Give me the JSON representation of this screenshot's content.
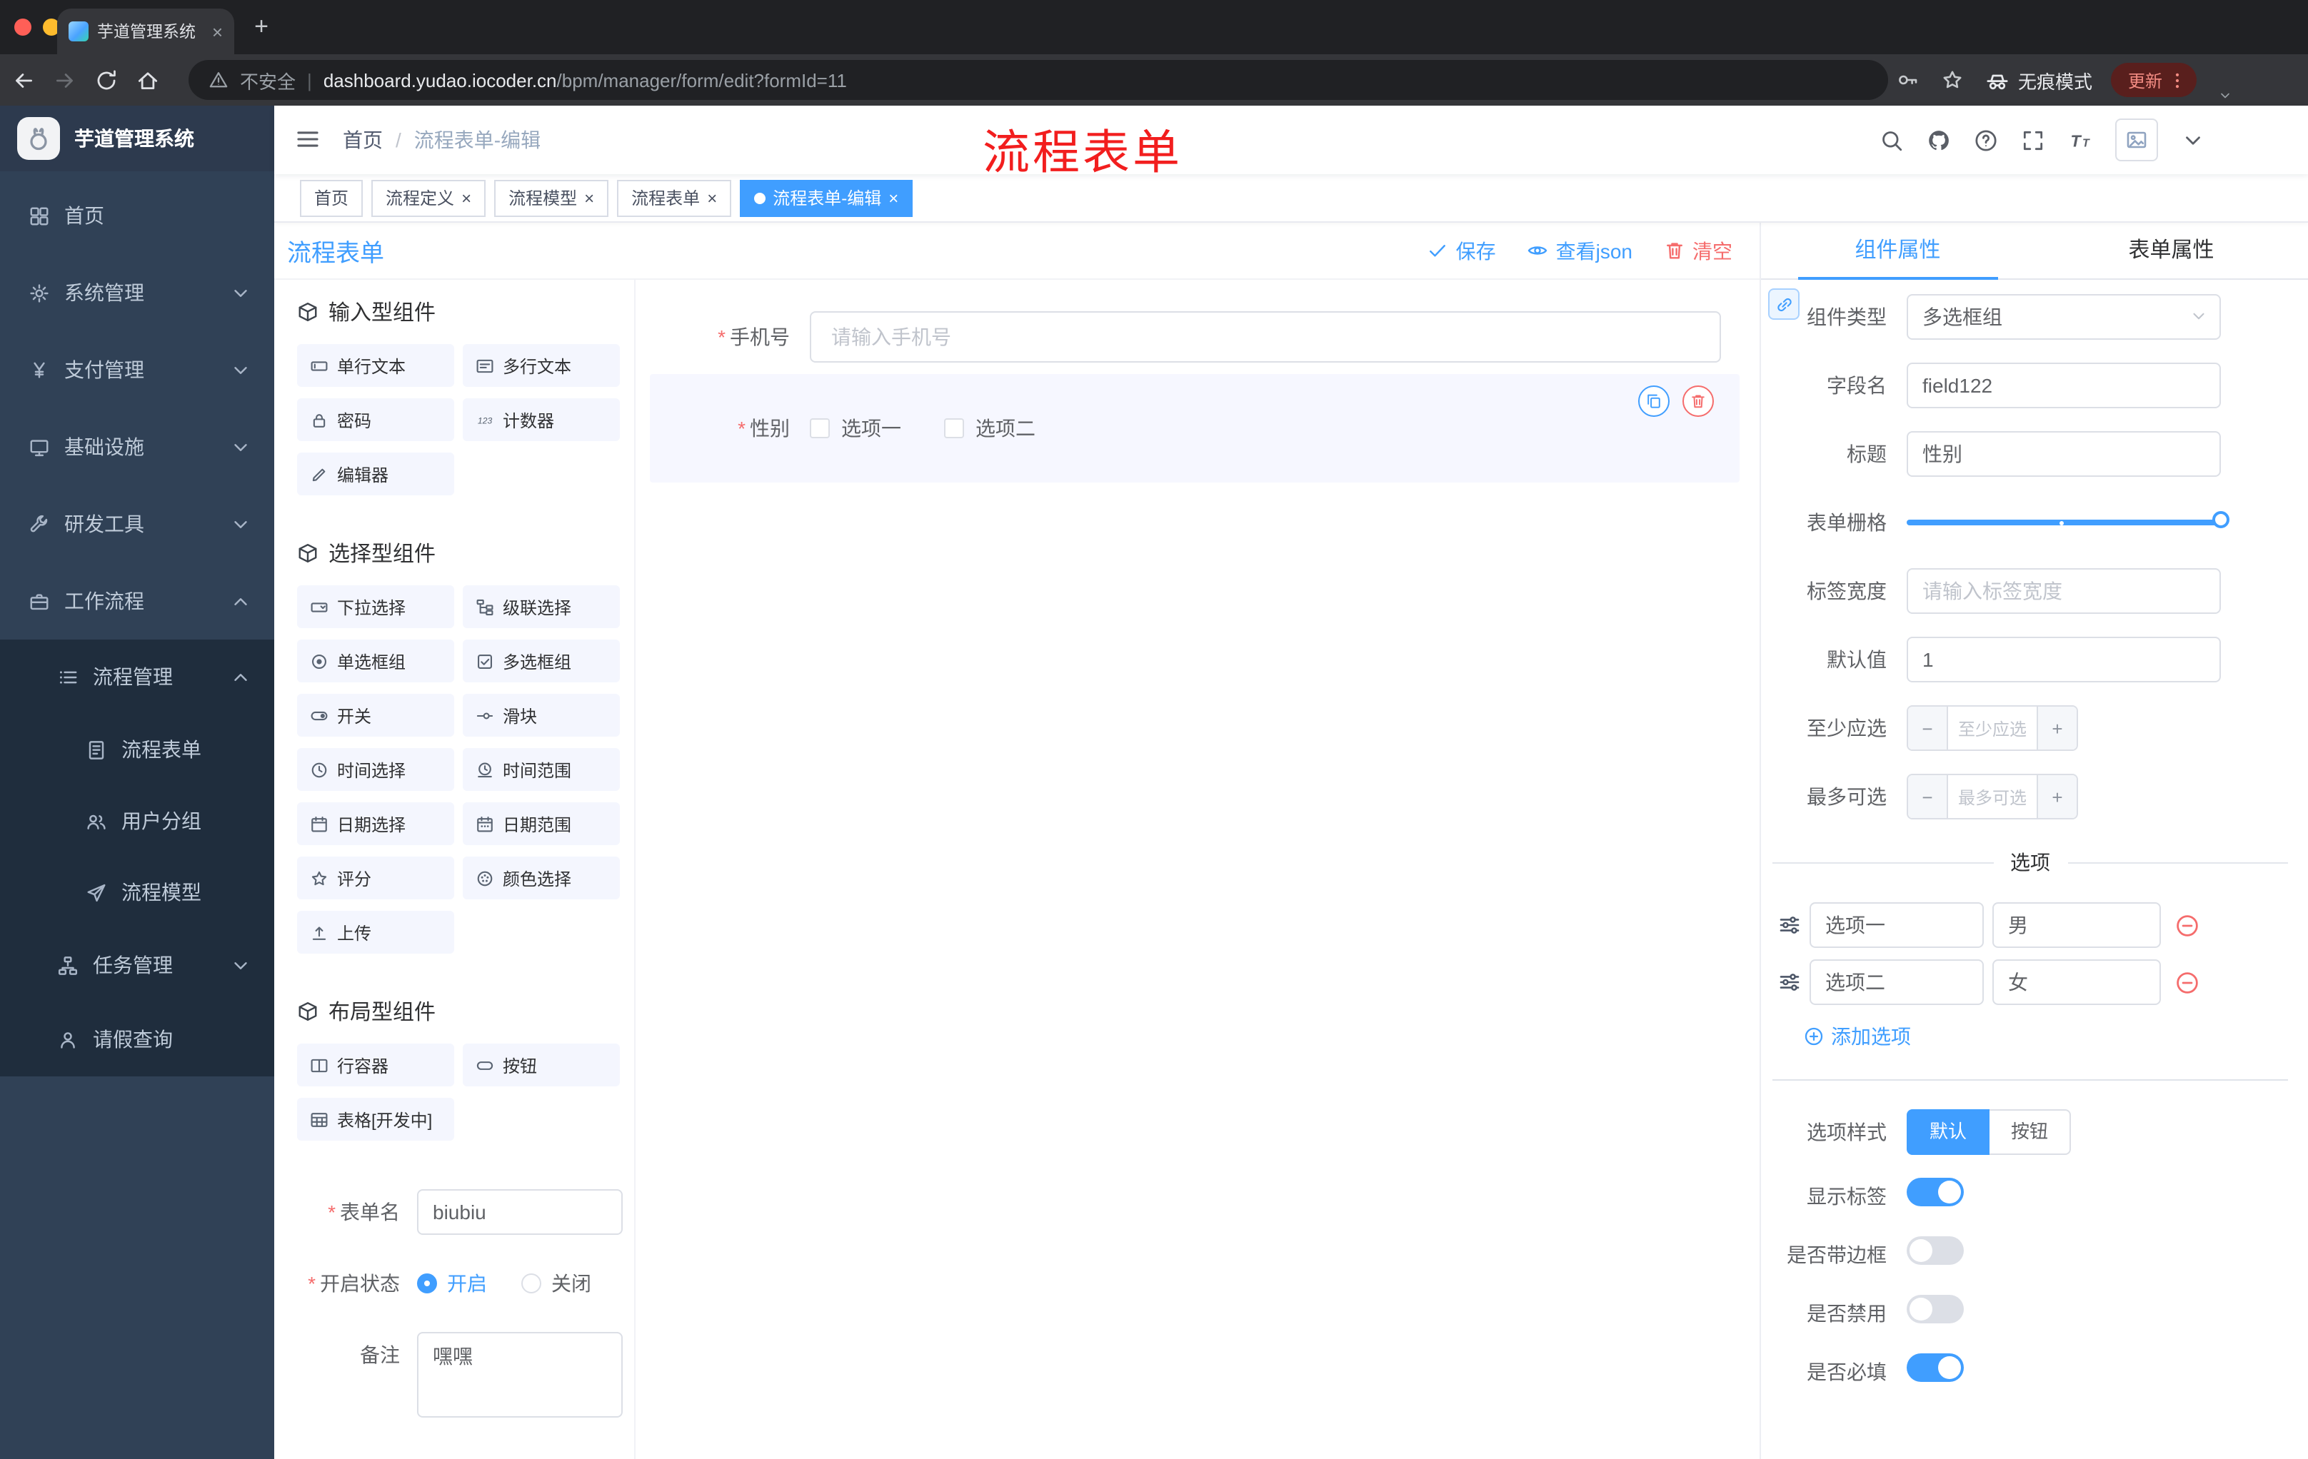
{
  "colors": {
    "accent": "#409EFF",
    "danger": "#F56C6C",
    "sidebar_bg": "#304156",
    "submenu_bg": "#1F2D3D",
    "tag_active_bg": "#409EFF",
    "annotation_red": "#F21E1E"
  },
  "glyphs": {
    "close": "×",
    "plus": "+",
    "required": "*",
    "breadcrumb_sep": "/",
    "url_divider": "|",
    "minus": "−"
  },
  "icons": {
    "tab-favicon": "colored-square",
    "address-warning": "warning-triangle",
    "password-key": "key",
    "bookmark": "star",
    "incognito": "spy-face",
    "browser-menu": "vertical-dots",
    "search": "magnifier",
    "repo": "github-cat",
    "help": "question-circle",
    "fullscreen": "expand-corners",
    "font-size": "double-T",
    "avatar": "broken-image",
    "sidebar-toggle": "hamburger"
  },
  "browser": {
    "tab_title": "芋道管理系统",
    "security_label": "不安全",
    "url_host": "dashboard.yudao.iocoder.cn",
    "url_path": "/bpm/manager/form/edit?formId=11",
    "incognito_label": "无痕模式",
    "update_label": "更新"
  },
  "sidebar": {
    "logo_title": "芋道管理系统",
    "home": "首页",
    "system": "系统管理",
    "payment": "支付管理",
    "infra": "基础设施",
    "devtools": "研发工具",
    "workflow": "工作流程",
    "process_mgmt": "流程管理",
    "process_form": "流程表单",
    "user_group": "用户分组",
    "process_model": "流程模型",
    "task_mgmt": "任务管理",
    "leave_query": "请假查询"
  },
  "header": {
    "breadcrumb_home": "首页",
    "breadcrumb_current": "流程表单-编辑",
    "annotation": "流程表单"
  },
  "tags_view": {
    "items": [
      {
        "label": "首页",
        "active": false,
        "closable": false
      },
      {
        "label": "流程定义",
        "active": false,
        "closable": true
      },
      {
        "label": "流程模型",
        "active": false,
        "closable": true
      },
      {
        "label": "流程表单",
        "active": false,
        "closable": true
      },
      {
        "label": "流程表单-编辑",
        "active": true,
        "closable": true
      }
    ]
  },
  "editor": {
    "title": "流程表单",
    "actions": {
      "save": "保存",
      "view_json": "查看json",
      "clear": "清空"
    },
    "library": {
      "section_input": "输入型组件",
      "input_items": [
        {
          "label": "单行文本",
          "icon": "text-field"
        },
        {
          "label": "多行文本",
          "icon": "textarea"
        },
        {
          "label": "密码",
          "icon": "lock"
        },
        {
          "label": "计数器",
          "icon": "counter"
        },
        {
          "label": "编辑器",
          "icon": "editor"
        }
      ],
      "section_select": "选择型组件",
      "select_items": [
        {
          "label": "下拉选择",
          "icon": "select"
        },
        {
          "label": "级联选择",
          "icon": "cascader"
        },
        {
          "label": "单选框组",
          "icon": "radio"
        },
        {
          "label": "多选框组",
          "icon": "checkbox"
        },
        {
          "label": "开关",
          "icon": "switch"
        },
        {
          "label": "滑块",
          "icon": "slider"
        },
        {
          "label": "时间选择",
          "icon": "time"
        },
        {
          "label": "时间范围",
          "icon": "time-range"
        },
        {
          "label": "日期选择",
          "icon": "date"
        },
        {
          "label": "日期范围",
          "icon": "date-range"
        },
        {
          "label": "评分",
          "icon": "star"
        },
        {
          "label": "颜色选择",
          "icon": "color"
        },
        {
          "label": "上传",
          "icon": "upload"
        }
      ],
      "section_layout": "布局型组件",
      "layout_items": [
        {
          "label": "行容器",
          "icon": "row"
        },
        {
          "label": "按钮",
          "icon": "button"
        },
        {
          "label": "表格[开发中]",
          "icon": "table"
        }
      ]
    },
    "meta": {
      "form_name_label": "表单名",
      "form_name_value": "biubiu",
      "status_label": "开启状态",
      "status_on": "开启",
      "status_off": "关闭",
      "status_value": "开启",
      "remark_label": "备注",
      "remark_value": "嘿嘿"
    },
    "canvas": {
      "phone_label": "手机号",
      "phone_placeholder": "请输入手机号",
      "gender_label": "性别",
      "gender_option1": "选项一",
      "gender_option2": "选项二"
    },
    "props": {
      "tab_component": "组件属性",
      "tab_form": "表单属性",
      "type_label": "组件类型",
      "type_value": "多选框组",
      "field_label": "字段名",
      "field_value": "field122",
      "title_label": "标题",
      "title_value": "性别",
      "grid_label": "表单栅格",
      "grid_value": 24,
      "grid_max": 24,
      "width_label": "标签宽度",
      "width_placeholder": "请输入标签宽度",
      "default_label": "默认值",
      "default_value": "1",
      "min_label": "至少应选",
      "min_placeholder": "至少应选",
      "max_label": "最多可选",
      "max_placeholder": "最多可选",
      "options_title": "选项",
      "options": [
        {
          "name": "选项一",
          "value": "男"
        },
        {
          "name": "选项二",
          "value": "女"
        }
      ],
      "add_option": "添加选项",
      "style_label": "选项样式",
      "style_default": "默认",
      "style_button": "按钮",
      "style_value": "默认",
      "show_label": "显示标签",
      "show_value": true,
      "border_label": "是否带边框",
      "border_value": false,
      "disabled_label": "是否禁用",
      "disabled_value": false,
      "required_label": "是否必填",
      "required_value": true
    }
  }
}
